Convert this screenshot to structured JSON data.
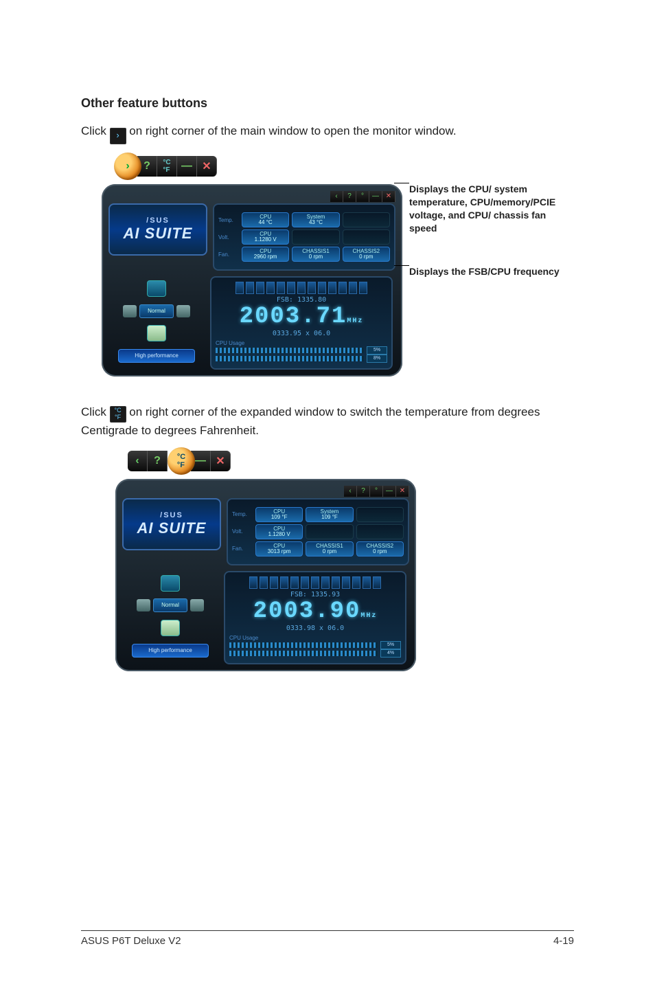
{
  "heading": "Other feature buttons",
  "para1_pre": "Click ",
  "para1_post": " on right corner of the main window to open the monitor window.",
  "para2_pre": "Click ",
  "para2_post": " on right corner of the expanded window to switch the temperature from degrees Centigrade to degrees Fahrenheit.",
  "logo_top": "/SUS",
  "logo_bottom": "AI SUITE",
  "mode_label": "Normal",
  "hp_btn": "High performance",
  "callout1": "Displays the CPU/ system temperature, CPU/memory/PCIE voltage, and CPU/ chassis fan speed",
  "callout2": "Displays the FSB/CPU frequency",
  "fig1": {
    "temp_lab": "Temp.",
    "volt_lab": "Volt.",
    "fan_lab": "Fan.",
    "temp_cpu_n": "CPU",
    "temp_cpu_v": "44 °C",
    "temp_sys_n": "System",
    "temp_sys_v": "43 °C",
    "volt_cpu_n": "CPU",
    "volt_cpu_v": "1.1280 V",
    "fan_cpu_n": "CPU",
    "fan_cpu_v": "2960 rpm",
    "fan_c1_n": "CHASSIS1",
    "fan_c1_v": "0 rpm",
    "fan_c2_n": "CHASSIS2",
    "fan_c2_v": "0 rpm",
    "fsb": "FSB: 1335.80",
    "freq": "2003.71",
    "freq_unit": "MHz",
    "dram": "0333.95 x 06.0",
    "usage_lab": "CPU Usage",
    "u1": "5%",
    "u2": "8%"
  },
  "fig2": {
    "temp_lab": "Temp.",
    "volt_lab": "Volt.",
    "fan_lab": "Fan.",
    "temp_cpu_n": "CPU",
    "temp_cpu_v": "109 °F",
    "temp_sys_n": "System",
    "temp_sys_v": "109 °F",
    "volt_cpu_n": "CPU",
    "volt_cpu_v": "1.1280 V",
    "fan_cpu_n": "CPU",
    "fan_cpu_v": "3013 rpm",
    "fan_c1_n": "CHASSIS1",
    "fan_c1_v": "0 rpm",
    "fan_c2_n": "CHASSIS2",
    "fan_c2_v": "0 rpm",
    "fsb": "FSB: 1335.93",
    "freq": "2003.90",
    "freq_unit": "MHz",
    "dram": "0333.98 x 06.0",
    "usage_lab": "CPU Usage",
    "u1": "5%",
    "u2": "4%"
  },
  "footer_left": "ASUS P6T Deluxe V2",
  "footer_right": "4-19"
}
